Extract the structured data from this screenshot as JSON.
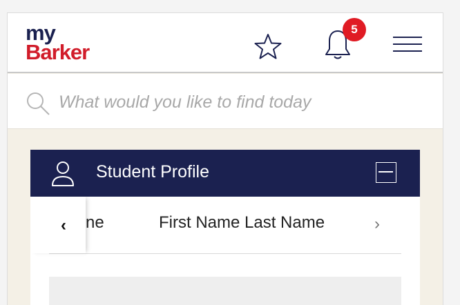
{
  "header": {
    "logo_line1": "my",
    "logo_line2": "Barker",
    "favorites_icon": "star-icon",
    "notifications_icon": "bell-icon",
    "notification_count": "5",
    "menu_icon": "hamburger-icon"
  },
  "search": {
    "placeholder": "What would you like to find today",
    "icon": "search-icon"
  },
  "profile_card": {
    "title": "Student Profile",
    "icon": "user-icon",
    "collapse_icon": "minus-square-icon",
    "prev_arrow": "‹",
    "prev_name_fragment": "ne",
    "current_name": "First Name Last Name",
    "next_arrow": "›"
  },
  "colors": {
    "navy": "#1b2150",
    "brand_red": "#d11c2a",
    "badge_red": "#e01b24",
    "beige_bg": "#f4f0e6"
  }
}
